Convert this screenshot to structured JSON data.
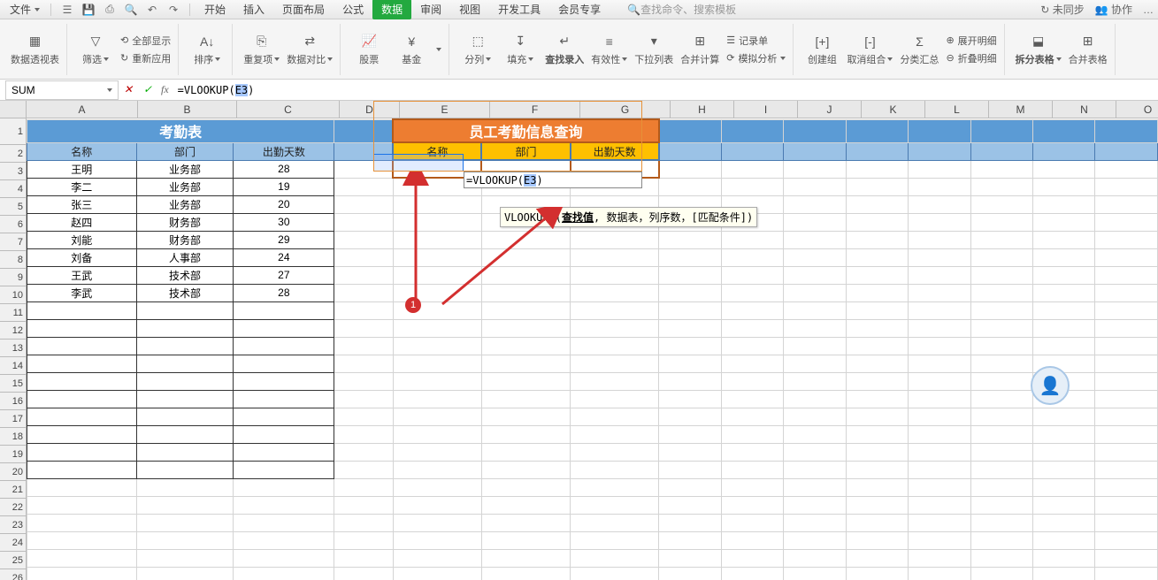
{
  "menu": {
    "file": "文件",
    "tabs": [
      "开始",
      "插入",
      "页面布局",
      "公式",
      "数据",
      "审阅",
      "视图",
      "开发工具",
      "会员专享"
    ],
    "active": 4,
    "search_placeholder": "查找命令、搜索模板",
    "right": {
      "sync": "未同步",
      "coop": "协作",
      "more": "…"
    }
  },
  "ribbon": {
    "pt": "数据透视表",
    "filter": "筛选",
    "showall": "全部显示",
    "reapply": "重新应用",
    "sort": "排序",
    "dup": "重复项",
    "compare": "数据对比",
    "stock": "股票",
    "fund": "基金",
    "split": "分列",
    "fill": "填充",
    "find": "查找录入",
    "validity": "有效性",
    "dropdown": "下拉列表",
    "consolidate": "合并计算",
    "record": "记录单",
    "sim": "模拟分析",
    "group": "创建组",
    "ungroup": "取消组合",
    "subtotal": "分类汇总",
    "expand": "展开明细",
    "collapse": "折叠明细",
    "split_tbl": "拆分表格",
    "merge_tbl": "合并表格"
  },
  "formula": {
    "name": "SUM",
    "text_before": "=VLOOKUP(",
    "text_sel": "E3",
    "text_after": ")",
    "tooltip_fn": "VLOOKUP",
    "tooltip_hl": "查找值",
    "tooltip_rest": " 数据表，列序数，[匹配条件])"
  },
  "att": {
    "title": "考勤表",
    "h1": "名称",
    "h2": "部门",
    "h3": "出勤天数",
    "rows": [
      {
        "n": "王明",
        "d": "业务部",
        "c": "28"
      },
      {
        "n": "李二",
        "d": "业务部",
        "c": "19"
      },
      {
        "n": "张三",
        "d": "业务部",
        "c": "20"
      },
      {
        "n": "赵四",
        "d": "财务部",
        "c": "30"
      },
      {
        "n": "刘能",
        "d": "财务部",
        "c": "29"
      },
      {
        "n": "刘备",
        "d": "人事部",
        "c": "24"
      },
      {
        "n": "王武",
        "d": "技术部",
        "c": "27"
      },
      {
        "n": "李武",
        "d": "技术部",
        "c": "28"
      }
    ]
  },
  "emp": {
    "title": "员工考勤信息查询",
    "h1": "名称",
    "h2": "部门",
    "h3": "出勤天数"
  },
  "cols": [
    "A",
    "B",
    "C",
    "D",
    "E",
    "F",
    "G",
    "H",
    "I",
    "J",
    "K",
    "L",
    "M",
    "N",
    "O"
  ],
  "callout": "1"
}
